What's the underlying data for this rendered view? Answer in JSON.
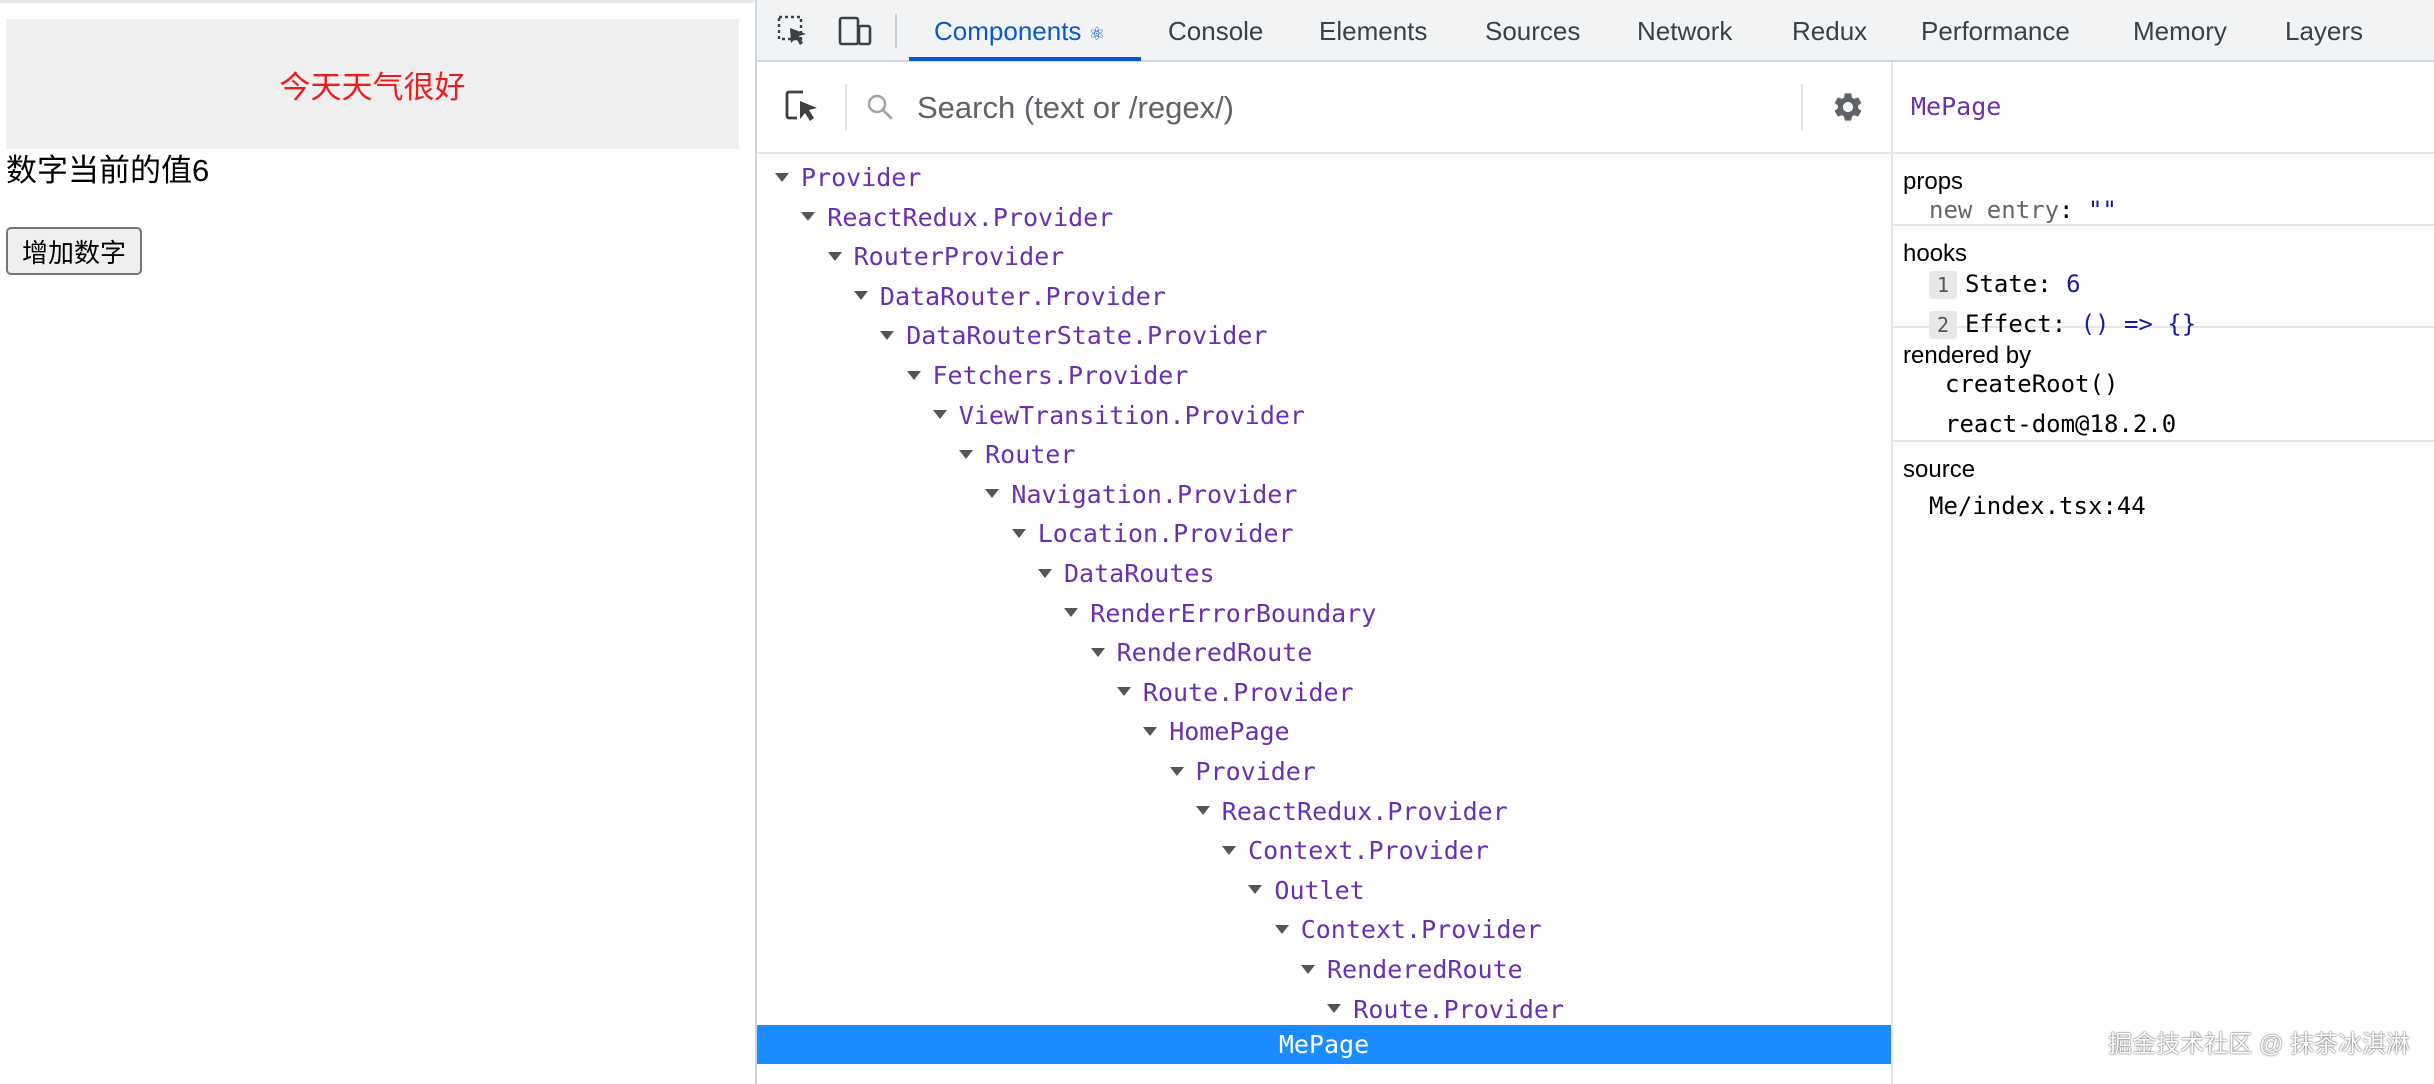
{
  "app": {
    "weather_text": "今天天气很好",
    "counter_text": "数字当前的值6",
    "add_button_label": "增加数字"
  },
  "devtools": {
    "tabs": [
      {
        "label": "Components",
        "icon": "react-atom-icon",
        "active": true
      },
      {
        "label": "Console",
        "active": false
      },
      {
        "label": "Elements",
        "active": false
      },
      {
        "label": "Sources",
        "active": false
      },
      {
        "label": "Network",
        "active": false
      },
      {
        "label": "Redux",
        "active": false
      },
      {
        "label": "Performance",
        "active": false
      },
      {
        "label": "Memory",
        "active": false
      },
      {
        "label": "Layers",
        "active": false
      }
    ],
    "search": {
      "placeholder": "Search (text or /regex/)",
      "value": ""
    },
    "tree": [
      {
        "label": "Provider",
        "depth": 0
      },
      {
        "label": "ReactRedux.Provider",
        "depth": 1
      },
      {
        "label": "RouterProvider",
        "depth": 2
      },
      {
        "label": "DataRouter.Provider",
        "depth": 3
      },
      {
        "label": "DataRouterState.Provider",
        "depth": 4
      },
      {
        "label": "Fetchers.Provider",
        "depth": 5
      },
      {
        "label": "ViewTransition.Provider",
        "depth": 6
      },
      {
        "label": "Router",
        "depth": 7
      },
      {
        "label": "Navigation.Provider",
        "depth": 8
      },
      {
        "label": "Location.Provider",
        "depth": 9
      },
      {
        "label": "DataRoutes",
        "depth": 10
      },
      {
        "label": "RenderErrorBoundary",
        "depth": 11
      },
      {
        "label": "RenderedRoute",
        "depth": 12
      },
      {
        "label": "Route.Provider",
        "depth": 13
      },
      {
        "label": "HomePage",
        "depth": 14
      },
      {
        "label": "Provider",
        "depth": 15
      },
      {
        "label": "ReactRedux.Provider",
        "depth": 16
      },
      {
        "label": "Context.Provider",
        "depth": 17
      },
      {
        "label": "Outlet",
        "depth": 18
      },
      {
        "label": "Context.Provider",
        "depth": 19
      },
      {
        "label": "RenderedRoute",
        "depth": 20
      },
      {
        "label": "Route.Provider",
        "depth": 21
      }
    ],
    "selected_component": "MePage",
    "inspector": {
      "component_name": "MePage",
      "props_title": "props",
      "props": [
        {
          "key": "new entry",
          "value": "\"\""
        }
      ],
      "hooks_title": "hooks",
      "hooks": [
        {
          "index": "1",
          "name": "State:",
          "value": "6"
        },
        {
          "index": "2",
          "name": "Effect:",
          "value": "() => {}"
        }
      ],
      "rendered_by_title": "rendered by",
      "rendered_by": [
        "createRoot()",
        "react-dom@18.2.0"
      ],
      "source_title": "source",
      "source": "Me/index.tsx:44"
    },
    "colors": {
      "accent": "#0b57d0",
      "selected_row": "#1a8cff",
      "component_name": "#6a2fb2"
    }
  },
  "watermark": "掘金技术社区 @ 抹茶冰淇淋"
}
